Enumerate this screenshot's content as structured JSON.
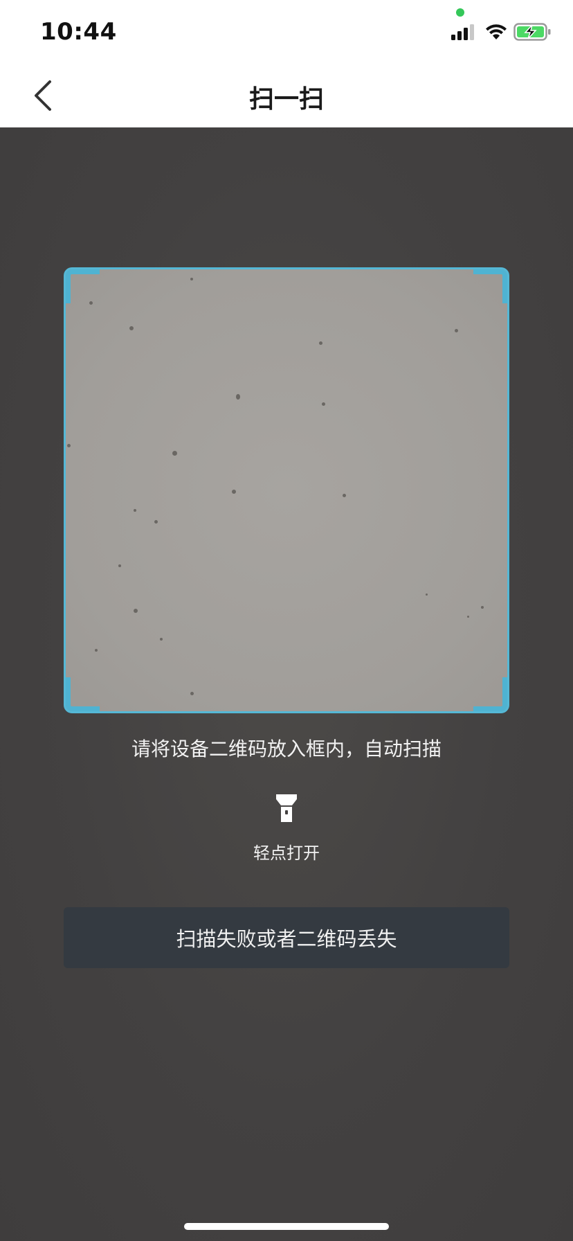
{
  "status_bar": {
    "time": "10:44",
    "icons": [
      "signal-icon",
      "wifi-icon",
      "battery-charging-icon"
    ],
    "battery_color": "#4cd964"
  },
  "nav": {
    "title": "扫一扫",
    "back_icon": "chevron-left-icon"
  },
  "scanner": {
    "frame_color": "#55b8d6",
    "hint": "请将设备二维码放入框内，自动扫描",
    "flashlight_icon": "flashlight-icon",
    "flashlight_label": "轻点打开"
  },
  "actions": {
    "fail_button_label": "扫描失败或者二维码丢失"
  }
}
